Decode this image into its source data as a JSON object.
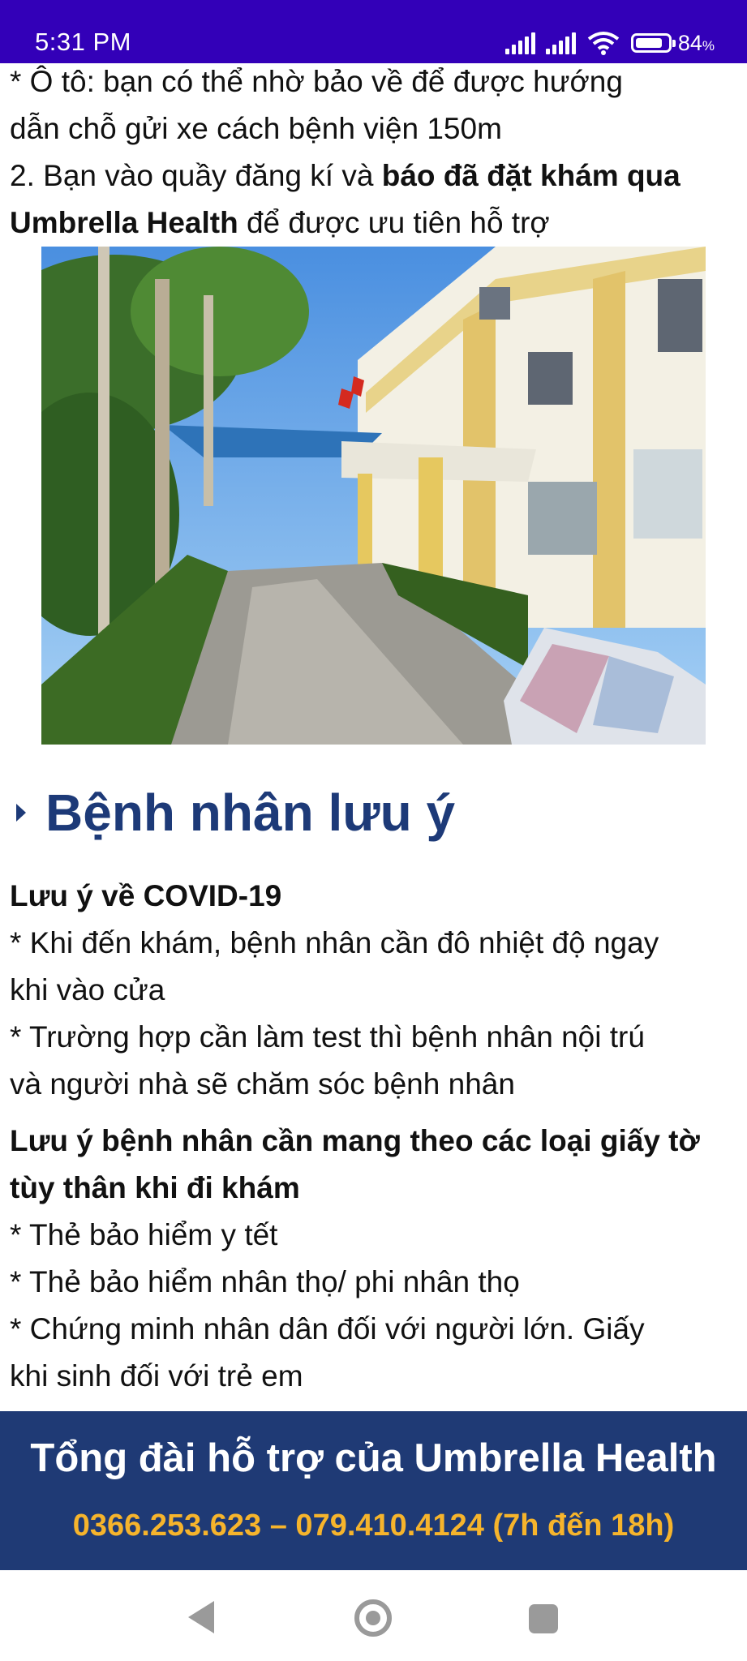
{
  "status_bar": {
    "time": "5:31 PM",
    "battery_percent": "84",
    "battery_unit": "%",
    "battery_level": 0.84,
    "icons": [
      "signal-icon",
      "signal-icon",
      "wifi-icon",
      "battery-icon"
    ]
  },
  "content": {
    "line1": " * Ô tô: bạn có thể nhờ bảo về để được hướng",
    "line2": "dẫn chỗ gửi xe cách bệnh viện 150m",
    "line3_pre": " 2. Bạn vào quầy đăng kí và ",
    "line3_bold": "báo đã đặt khám qua",
    "line4_bold": "Umbrella Health",
    "line4_post": " để được ưu tiên hỗ trợ"
  },
  "section": {
    "title": "Bệnh nhân lưu ý",
    "covid_heading": "Lưu ý về COVID-19",
    "covid_1a": " * Khi đến khám, bệnh nhân cần đô nhiệt độ ngay",
    "covid_1b": "khi vào cửa",
    "covid_2a": " * Trường hợp cần làm test thì bệnh nhân nội trú",
    "covid_2b": "và người nhà sẽ chăm sóc bệnh nhân",
    "docs_heading_a": " Lưu ý bệnh nhân cần mang theo các loại giấy tờ",
    "docs_heading_b": "tùy thân khi đi khám",
    "doc_1": " * Thẻ bảo hiểm y tết",
    "doc_2": " * Thẻ bảo hiểm nhân thọ/ phi nhân thọ",
    "doc_3a": " * Chứng minh nhân dân đối với người lớn. Giấy",
    "doc_3b": "khi sinh đối với trẻ em"
  },
  "footer": {
    "title": "Tổng đài hỗ trợ của Umbrella Health",
    "phone": "0366.253.623 – 079.410.4124 (7h đến 18h)"
  },
  "colors": {
    "status_bar": "#3300b8",
    "heading": "#1d3a78",
    "footer_bg": "#1f3a75",
    "footer_phone": "#f6b42c"
  }
}
